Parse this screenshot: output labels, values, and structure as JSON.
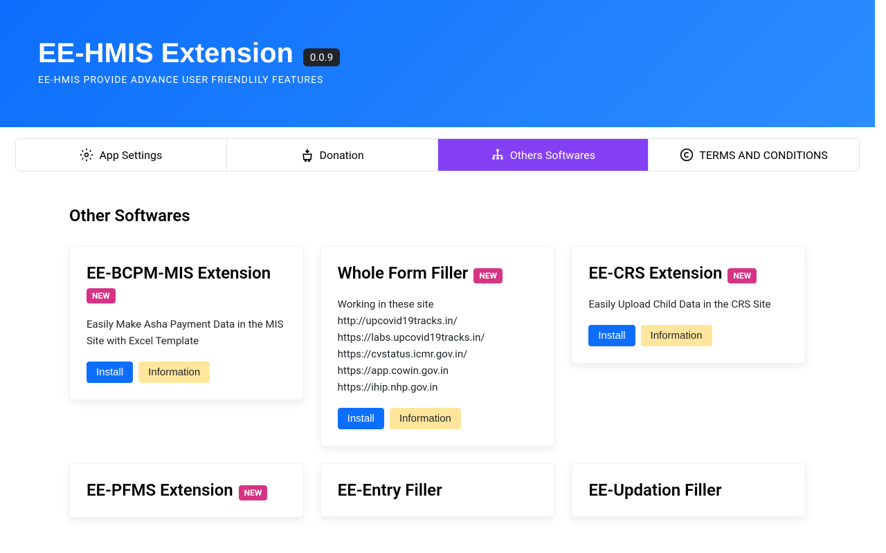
{
  "hero": {
    "title": "EE-HMIS Extension",
    "version": "0.0.9",
    "subtitle": "EE-HMIS PROVIDE ADVANCE USER FRIENDLILY FEATURES"
  },
  "tabs": {
    "settings": "App Settings",
    "donation": "Donation",
    "others": "Others Softwares",
    "terms": "TERMS AND CONDITIONS"
  },
  "section": {
    "title": "Other Softwares"
  },
  "cards": {
    "bcpm": {
      "title": "EE-BCPM-MIS Extension",
      "badge": "NEW",
      "description": "Easily Make Asha Payment Data in the MIS Site with Excel Template",
      "install": "Install",
      "info": "Information"
    },
    "whole": {
      "title": "Whole Form Filler",
      "badge": "NEW",
      "description": "Working in these site\nhttp://upcovid19tracks.in/\nhttps://labs.upcovid19tracks.in/\nhttps://cvstatus.icmr.gov.in/\nhttps://app.cowin.gov.in\nhttps://ihip.nhp.gov.in",
      "install": "Install",
      "info": "Information"
    },
    "crs": {
      "title": "EE-CRS Extension",
      "badge": "NEW",
      "description": "Easily Upload Child Data in the CRS Site",
      "install": "Install",
      "info": "Information"
    },
    "pfms": {
      "title": "EE-PFMS Extension",
      "badge": "NEW"
    },
    "entry": {
      "title": "EE-Entry Filler"
    },
    "updation": {
      "title": "EE-Updation Filler"
    }
  }
}
